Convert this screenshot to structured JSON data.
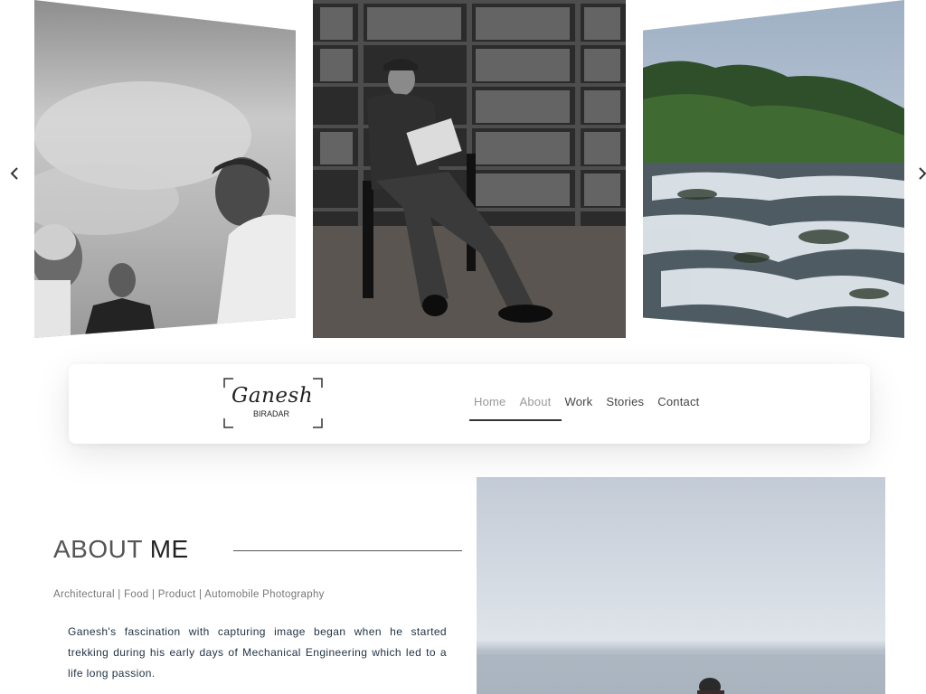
{
  "carousel": {
    "prev_icon": "chevron-left-icon",
    "next_icon": "chevron-right-icon",
    "slides": [
      {
        "name": "men-against-sky-photo"
      },
      {
        "name": "man-reading-library-photo"
      },
      {
        "name": "waterfall-photo"
      }
    ]
  },
  "logo": {
    "script": "Ganesh",
    "sub": "BIRADAR"
  },
  "nav": {
    "items": [
      {
        "label": "Home",
        "state": "muted"
      },
      {
        "label": "About",
        "state": "active"
      },
      {
        "label": "Work",
        "state": "normal"
      },
      {
        "label": "Stories",
        "state": "normal"
      },
      {
        "label": "Contact",
        "state": "normal"
      }
    ]
  },
  "about": {
    "title_light": "ABOUT ",
    "title_bold": "ME",
    "tagline": "Architectural | Food | Product | Automobile Photography",
    "paragraph": "Ganesh's fascination with capturing image began when he started trekking during his early days of Mechanical Engineering which led to a life long passion."
  },
  "colors": {
    "text_dark": "#222222",
    "text_muted": "#999999",
    "paragraph": "#223344"
  }
}
